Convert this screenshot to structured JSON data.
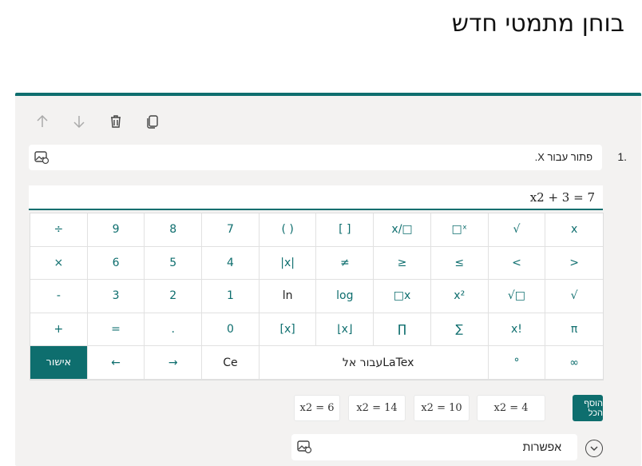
{
  "page": {
    "title": "בוחן מתמטי חדש"
  },
  "toolbar": {
    "icons": [
      "arrow-up-icon",
      "arrow-down-icon",
      "trash-icon",
      "copy-icon"
    ]
  },
  "question": {
    "number": "1.",
    "text": "פתור עבור X."
  },
  "formula": {
    "value": "x2 + 3 = 7"
  },
  "keypad": {
    "rows": [
      [
        "÷",
        "9",
        "8",
        "7",
        "( )",
        "[ ]",
        "x/□",
        "□ˣ",
        "√",
        "x"
      ],
      [
        "×",
        "6",
        "5",
        "4",
        "|x|",
        "≠",
        "≥",
        "≤",
        "<",
        ">"
      ],
      [
        "-",
        "3",
        "2",
        "1",
        "ln",
        "log",
        "□x",
        "x²",
        "√□",
        "√"
      ],
      [
        "+",
        "=",
        ".",
        "0",
        "[x]",
        "⌊x⌋",
        "∏",
        "∑",
        "x!",
        "π"
      ]
    ],
    "confirm": "אישור",
    "back": "←",
    "forward": "→",
    "ce": "Ce",
    "latex_label": "עבור אל",
    "latex_word": "LaTex",
    "degree": "°",
    "infinity": "∞"
  },
  "suggestions": [
    "x2 = 6",
    "x2 = 14",
    "x2 = 10",
    "x2 = 4"
  ],
  "add_all": "הוסף הכל",
  "option": {
    "text": "אפשרות"
  }
}
